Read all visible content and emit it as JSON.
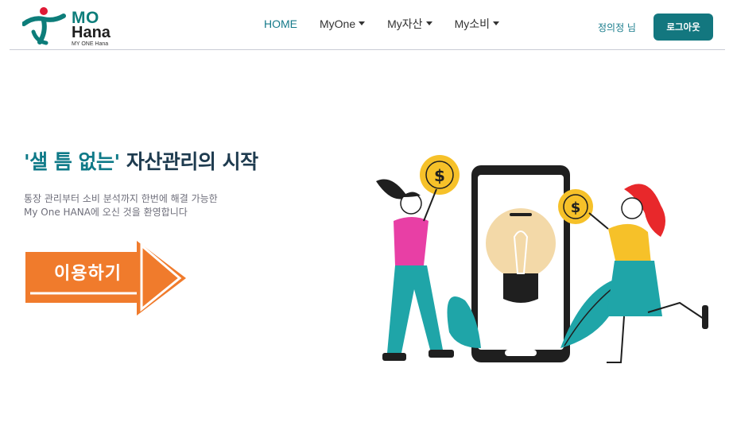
{
  "brand": {
    "logo_top": "MO",
    "logo_bottom": "Hana",
    "logo_sub": "MY ONE Hana"
  },
  "nav": {
    "items": [
      {
        "label": "HOME",
        "has_dropdown": false,
        "active": true
      },
      {
        "label": "MyOne",
        "has_dropdown": true,
        "active": false
      },
      {
        "label": "My자산",
        "has_dropdown": true,
        "active": false
      },
      {
        "label": "My소비",
        "has_dropdown": true,
        "active": false
      }
    ]
  },
  "user": {
    "greeting": "정의정 님",
    "logout_label": "로그아웃"
  },
  "hero": {
    "title_accent": "'샐 틈 없는'",
    "title_rest": " 자산관리의 시작",
    "desc_line1": "통장 관리부터 소비 분석까지 한번에 해결 가능한",
    "desc_line2": "My One HANA에 오신 것을 환영합니다",
    "cta_label": "이용하기"
  },
  "icons": {
    "coin_symbol": "$"
  },
  "colors": {
    "brand_teal": "#13777f",
    "title_navy": "#1e3b4f",
    "cta_orange": "#f07b2c",
    "coin_yellow": "#f6c129",
    "pink_shirt": "#e83fa5",
    "teal_pants": "#1fa5a8",
    "red_hair": "#e8282b"
  }
}
